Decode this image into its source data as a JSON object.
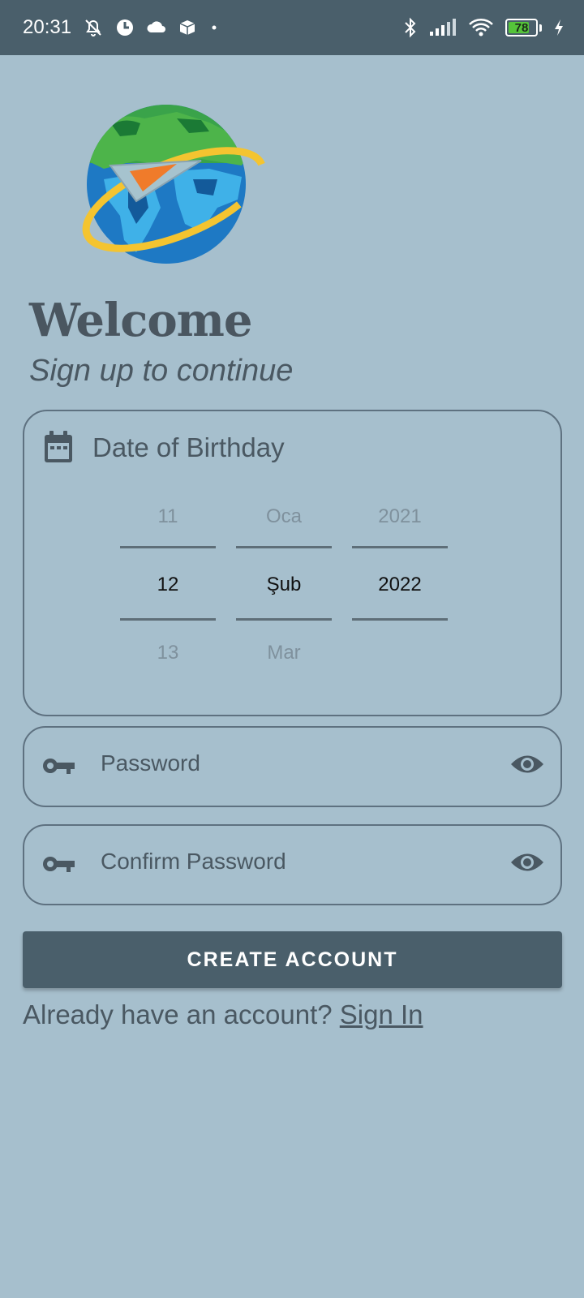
{
  "status_bar": {
    "time": "20:31",
    "battery_level": "78",
    "battery_percent": 78,
    "icons": [
      "alarm-off-icon",
      "app-icon",
      "cloud-icon",
      "box-icon",
      "dot-icon",
      "bluetooth-icon",
      "signal-icon",
      "wifi-icon",
      "battery-icon",
      "charging-icon"
    ]
  },
  "header": {
    "title": "Welcome",
    "subtitle": "Sign up to continue"
  },
  "dob": {
    "label": "Date of Birthday",
    "day": {
      "prev": "11",
      "current": "12",
      "next": "13"
    },
    "month": {
      "prev": "Oca",
      "current": "Şub",
      "next": "Mar"
    },
    "year": {
      "prev": "2021",
      "current": "2022",
      "next": ""
    }
  },
  "password": {
    "placeholder": "Password",
    "value": ""
  },
  "confirm_password": {
    "placeholder": "Confirm Password",
    "value": ""
  },
  "create_button": {
    "label": "CREATE ACCOUNT"
  },
  "signin": {
    "prompt": "Already have an account? ",
    "link_label": "Sign In"
  },
  "colors": {
    "background": "#a6bfcd",
    "primary": "#4a5f6b",
    "text": "#4a5862"
  }
}
